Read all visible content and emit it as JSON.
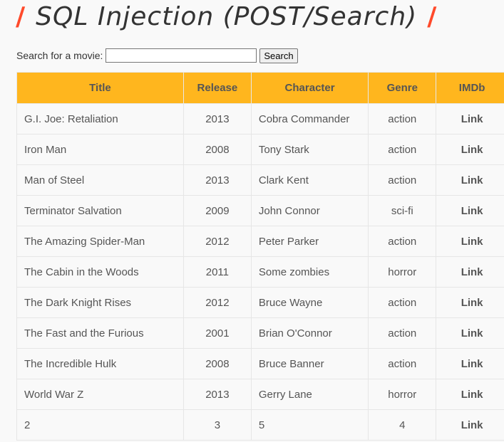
{
  "header": {
    "slash_left": "/",
    "title": "SQL Injection (POST/Search)",
    "slash_right": "/"
  },
  "search": {
    "label": "Search for a movie:",
    "value": "",
    "placeholder": "",
    "button_label": "Search"
  },
  "table": {
    "columns": [
      "Title",
      "Release",
      "Character",
      "Genre",
      "IMDb"
    ],
    "rows": [
      {
        "title": "G.I. Joe: Retaliation",
        "release": "2013",
        "character": "Cobra Commander",
        "genre": "action",
        "imdb": "Link"
      },
      {
        "title": "Iron Man",
        "release": "2008",
        "character": "Tony Stark",
        "genre": "action",
        "imdb": "Link"
      },
      {
        "title": "Man of Steel",
        "release": "2013",
        "character": "Clark Kent",
        "genre": "action",
        "imdb": "Link"
      },
      {
        "title": "Terminator Salvation",
        "release": "2009",
        "character": "John Connor",
        "genre": "sci-fi",
        "imdb": "Link"
      },
      {
        "title": "The Amazing Spider-Man",
        "release": "2012",
        "character": "Peter Parker",
        "genre": "action",
        "imdb": "Link"
      },
      {
        "title": "The Cabin in the Woods",
        "release": "2011",
        "character": "Some zombies",
        "genre": "horror",
        "imdb": "Link"
      },
      {
        "title": "The Dark Knight Rises",
        "release": "2012",
        "character": "Bruce Wayne",
        "genre": "action",
        "imdb": "Link"
      },
      {
        "title": "The Fast and the Furious",
        "release": "2001",
        "character": "Brian O'Connor",
        "genre": "action",
        "imdb": "Link"
      },
      {
        "title": "The Incredible Hulk",
        "release": "2008",
        "character": "Bruce Banner",
        "genre": "action",
        "imdb": "Link"
      },
      {
        "title": "World War Z",
        "release": "2013",
        "character": "Gerry Lane",
        "genre": "horror",
        "imdb": "Link"
      },
      {
        "title": "2",
        "release": "3",
        "character": "5",
        "genre": "4",
        "imdb": "Link"
      }
    ]
  },
  "colors": {
    "accent_slash": "#ff4a2b",
    "table_header_bg": "#ffb61e",
    "page_bg": "#f9f9f9"
  }
}
